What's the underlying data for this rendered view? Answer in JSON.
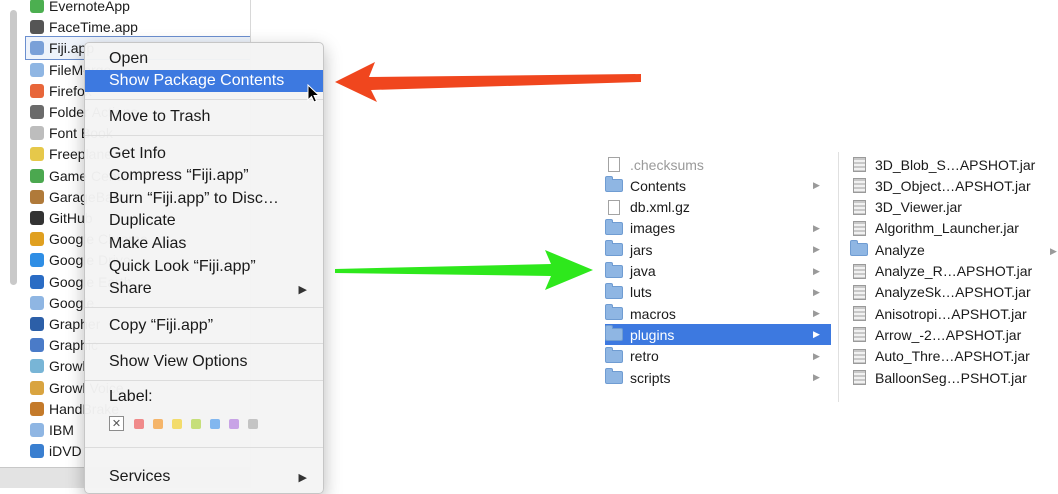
{
  "finder_list": {
    "items": [
      {
        "name": "EvernoteApp",
        "icon": "evernote-icon",
        "color": "#4caf50"
      },
      {
        "name": "FaceTime.app",
        "icon": "facetime-icon",
        "color": "#555555"
      },
      {
        "name": "Fiji.app",
        "icon": "fiji-icon",
        "color": "#7aa0d8",
        "selected": true
      },
      {
        "name": "FileMerge",
        "icon": "folder-icon",
        "color": "#8fb6e3"
      },
      {
        "name": "Firefox",
        "icon": "firefox-icon",
        "color": "#e8663a"
      },
      {
        "name": "Folder Actions",
        "icon": "font-book-icon",
        "color": "#6b6b6b"
      },
      {
        "name": "Font Book",
        "icon": "font-icon",
        "color": "#bdbdbd"
      },
      {
        "name": "Freeplane",
        "icon": "freeplane-icon",
        "color": "#e6c84a"
      },
      {
        "name": "Game Center",
        "icon": "game-center-icon",
        "color": "#4ba84f"
      },
      {
        "name": "GarageBand",
        "icon": "guitar-icon",
        "color": "#b07a3a"
      },
      {
        "name": "GitHub",
        "icon": "github-icon",
        "color": "#333333"
      },
      {
        "name": "Google Chrome",
        "icon": "chrome-icon",
        "color": "#e0a020"
      },
      {
        "name": "Google Drive",
        "icon": "drive-icon",
        "color": "#2f8ee5"
      },
      {
        "name": "Google Earth",
        "icon": "earth-icon",
        "color": "#2a6cc4"
      },
      {
        "name": "Google",
        "icon": "folder-icon",
        "color": "#8fb6e3"
      },
      {
        "name": "Grapher",
        "icon": "grapher-icon",
        "color": "#2c5fa8"
      },
      {
        "name": "Graphic",
        "icon": "graphic-icon",
        "color": "#4a7bc8"
      },
      {
        "name": "Growl",
        "icon": "growl-icon",
        "color": "#78b5d6"
      },
      {
        "name": "Growl Voice",
        "icon": "paw-icon",
        "color": "#d9a440"
      },
      {
        "name": "HandBrake",
        "icon": "handbrake-icon",
        "color": "#c47a2a"
      },
      {
        "name": "IBM",
        "icon": "folder-icon",
        "color": "#8fb6e3"
      },
      {
        "name": "iDVD",
        "icon": "idvd-icon",
        "color": "#3a7fd0"
      }
    ]
  },
  "context_menu": {
    "items": [
      {
        "label": "Open"
      },
      {
        "label": "Show Package Contents",
        "highlighted": true
      },
      {
        "label": "Move to Trash"
      },
      {
        "label": "Get Info"
      },
      {
        "label": "Compress “Fiji.app”"
      },
      {
        "label": "Burn “Fiji.app” to Disc…"
      },
      {
        "label": "Duplicate"
      },
      {
        "label": "Make Alias"
      },
      {
        "label": "Quick Look “Fiji.app”"
      },
      {
        "label": "Share",
        "submenu": true
      },
      {
        "label": "Copy “Fiji.app”"
      },
      {
        "label": "Show View Options"
      },
      {
        "label": "Services",
        "submenu": true
      }
    ],
    "label_title": "Label:",
    "label_colors": [
      "#f08a8a",
      "#f5b56a",
      "#f3dc6c",
      "#c6df7a",
      "#82b7ef",
      "#c8a3e6",
      "#c4c4c4"
    ],
    "highlight_color": "#3d79e0"
  },
  "arrows": {
    "red_color": "#f0461e",
    "green_color": "#2ee81c"
  },
  "package_browser": {
    "contents": [
      {
        "name": ".checksums",
        "kind": "file",
        "faded": true
      },
      {
        "name": "Contents",
        "kind": "folder"
      },
      {
        "name": "db.xml.gz",
        "kind": "file"
      },
      {
        "name": "images",
        "kind": "folder"
      },
      {
        "name": "jars",
        "kind": "folder"
      },
      {
        "name": "java",
        "kind": "folder"
      },
      {
        "name": "luts",
        "kind": "folder"
      },
      {
        "name": "macros",
        "kind": "folder"
      },
      {
        "name": "plugins",
        "kind": "folder",
        "selected": true
      },
      {
        "name": "retro",
        "kind": "folder"
      },
      {
        "name": "scripts",
        "kind": "folder"
      }
    ],
    "plugins": [
      {
        "name": "3D_Blob_S…APSHOT.jar",
        "kind": "jar"
      },
      {
        "name": "3D_Object…APSHOT.jar",
        "kind": "jar"
      },
      {
        "name": "3D_Viewer.jar",
        "kind": "jar"
      },
      {
        "name": "Algorithm_Launcher.jar",
        "kind": "jar"
      },
      {
        "name": "Analyze",
        "kind": "folder"
      },
      {
        "name": "Analyze_R…APSHOT.jar",
        "kind": "jar"
      },
      {
        "name": "AnalyzeSk…APSHOT.jar",
        "kind": "jar"
      },
      {
        "name": "Anisotropi…APSHOT.jar",
        "kind": "jar"
      },
      {
        "name": "Arrow_-2…APSHOT.jar",
        "kind": "jar"
      },
      {
        "name": "Auto_Thre…APSHOT.jar",
        "kind": "jar"
      },
      {
        "name": "BalloonSeg…PSHOT.jar",
        "kind": "jar"
      }
    ]
  }
}
